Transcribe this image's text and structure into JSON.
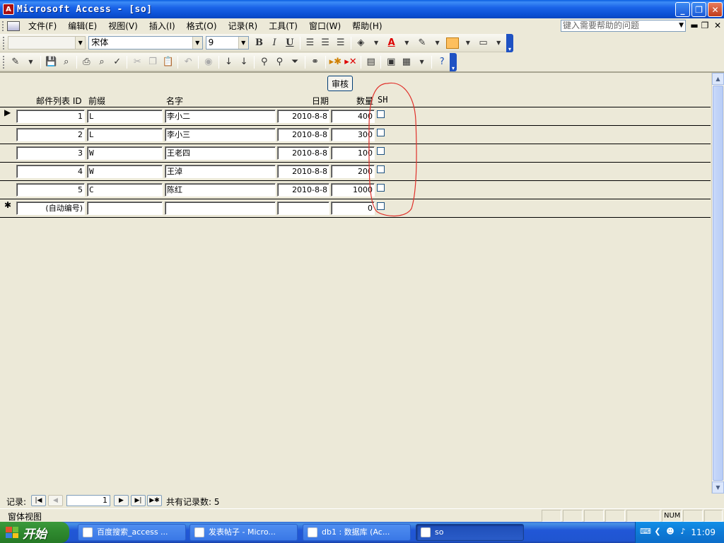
{
  "window": {
    "title": "Microsoft Access - [so]",
    "app_icon_letter": "A"
  },
  "menubar": {
    "items": [
      "文件(F)",
      "编辑(E)",
      "视图(V)",
      "插入(I)",
      "格式(O)",
      "记录(R)",
      "工具(T)",
      "窗口(W)",
      "帮助(H)"
    ],
    "help_placeholder": "键入需要帮助的问题"
  },
  "formatting_toolbar": {
    "object_combo": "",
    "font_combo": "宋体",
    "size_combo": "9",
    "bold_label": "B",
    "italic_label": "I",
    "underline_label": "U"
  },
  "form": {
    "audit_button_label": "审核",
    "columns": [
      "邮件列表 ID",
      "前缀",
      "名字",
      "日期",
      "数量",
      "SH"
    ],
    "rows": [
      {
        "id": "1",
        "prefix": "L",
        "name": "李小二",
        "date": "2010-8-8",
        "qty": "400",
        "sh": false
      },
      {
        "id": "2",
        "prefix": "L",
        "name": "李小三",
        "date": "2010-8-8",
        "qty": "300",
        "sh": false
      },
      {
        "id": "3",
        "prefix": "W",
        "name": "王老四",
        "date": "2010-8-8",
        "qty": "100",
        "sh": false
      },
      {
        "id": "4",
        "prefix": "W",
        "name": "王淖",
        "date": "2010-8-8",
        "qty": "200",
        "sh": false
      },
      {
        "id": "5",
        "prefix": "C",
        "name": "陈红",
        "date": "2010-8-8",
        "qty": "1000",
        "sh": false
      }
    ],
    "new_row": {
      "id": "(自动编号)",
      "prefix": "",
      "name": "",
      "date": "",
      "qty": "0",
      "sh": false
    },
    "current_row_marker": "▶",
    "new_row_marker": "✱"
  },
  "record_nav": {
    "label": "记录:",
    "current": "1",
    "total_text": "共有记录数: 5"
  },
  "status": {
    "text": "窗体视图",
    "num_indicator": "NUM"
  },
  "taskbar": {
    "start_label": "开始",
    "tasks": [
      {
        "label": "百度搜索_access ..."
      },
      {
        "label": "发表帖子 - Micro..."
      },
      {
        "label": "db1 : 数据库 (Ac..."
      },
      {
        "label": "so"
      }
    ],
    "clock": "11:09"
  },
  "colors": {
    "annotation_red": "#e0302a",
    "titlebar_blue": "#0b50d4",
    "face": "#ece9d8"
  }
}
